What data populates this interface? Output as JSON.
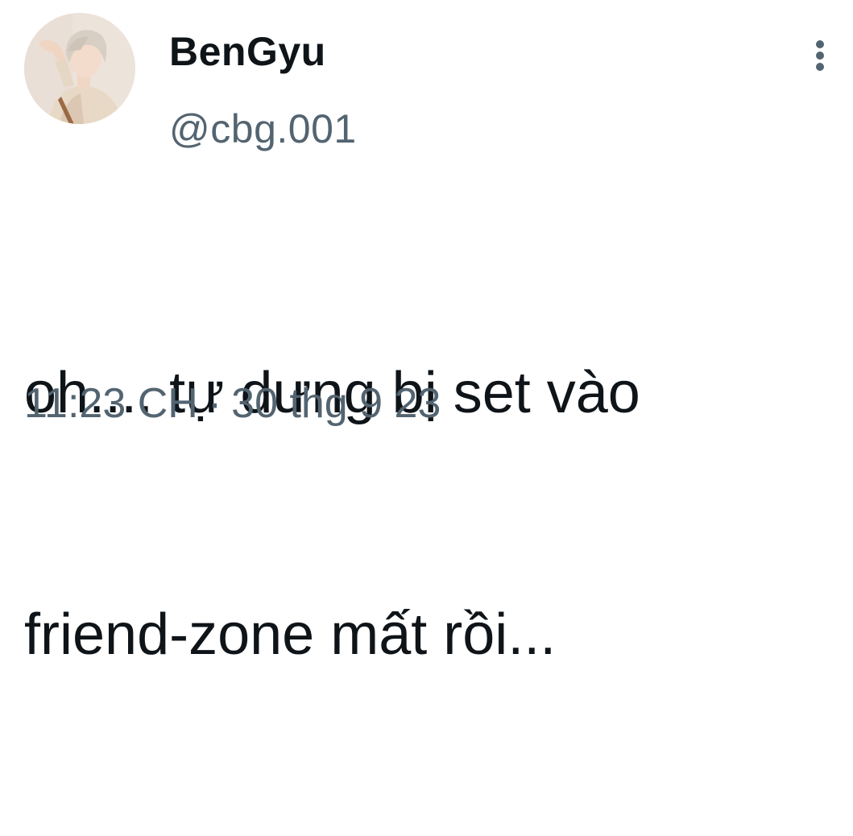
{
  "author": {
    "display_name": "BenGyu",
    "handle": "@cbg.001",
    "avatar_icon": "profile-photo"
  },
  "tweet": {
    "text_line_1": "oh.... tự dưng bị set vào",
    "text_line_2": "friend-zone mất rồi...",
    "time": "11:23 CH",
    "separator": "·",
    "date": "30 thg 9 23"
  },
  "more_icon": "more-vertical-icon",
  "colors": {
    "primary_text": "#0f1419",
    "secondary_text": "#536471",
    "background": "#ffffff"
  }
}
